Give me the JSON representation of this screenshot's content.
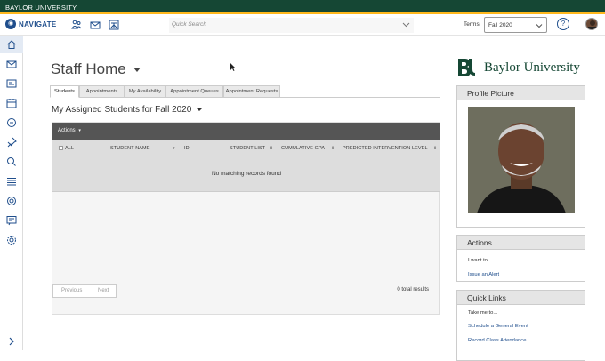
{
  "topbar": {
    "title": "BAYLOR UNIVERSITY"
  },
  "navbar": {
    "brand": "NAVIGATE",
    "search_placeholder": "Quick Search",
    "terms_label": "Terms",
    "terms_value": "Fall 2020",
    "help": "?"
  },
  "sidebar": {
    "items": [
      "home-icon",
      "mail-icon",
      "id-card-icon",
      "calendar-icon",
      "chat-icon",
      "pin-icon",
      "search-icon",
      "list-icon",
      "target-icon",
      "report-icon",
      "gear-icon"
    ]
  },
  "main": {
    "page_title": "Staff Home",
    "tabs": [
      "Students",
      "Appointments",
      "My Availability",
      "Appointment Queues",
      "Appointment Requests"
    ],
    "section_title": "My Assigned Students for Fall 2020",
    "actions_label": "Actions",
    "columns": [
      "ALL",
      "STUDENT NAME",
      "ID",
      "STUDENT LIST",
      "CUMULATIVE GPA",
      "PREDICTED INTERVENTION LEVEL"
    ],
    "empty_message": "No matching records found",
    "pager": {
      "prev": "Previous",
      "next": "Next"
    },
    "total": "0 total results"
  },
  "right": {
    "logo_text": "Baylor University",
    "profile_title": "Profile Picture",
    "actions_title": "Actions",
    "actions_intro": "I want to...",
    "actions_links": [
      "Issue an Alert"
    ],
    "quick_title": "Quick Links",
    "quick_intro": "Take me to...",
    "quick_links": [
      "Schedule a General Event",
      "Record Class Attendance"
    ]
  },
  "colors": {
    "brand_green": "#154734",
    "brand_gold": "#FFB81C",
    "navigate_blue": "#1f4e8c"
  }
}
